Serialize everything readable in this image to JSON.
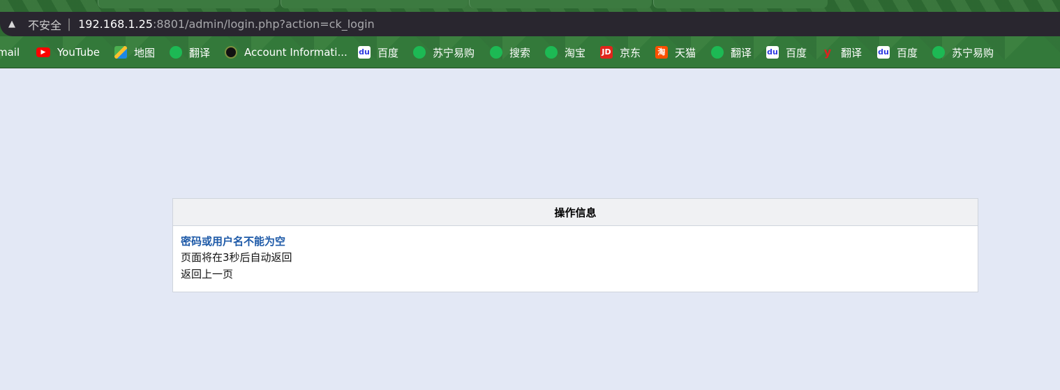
{
  "browser": {
    "insecure_label": "不安全",
    "url_host": "192.168.1.25",
    "url_rest": ":8801/admin/login.php?action=ck_login"
  },
  "bookmarks": [
    {
      "label": "mail",
      "icon": "gmail-icon"
    },
    {
      "label": "YouTube",
      "icon": "youtube-icon"
    },
    {
      "label": "地图",
      "icon": "maps-icon"
    },
    {
      "label": "翻译",
      "icon": "globe-icon"
    },
    {
      "label": "Account Informati...",
      "icon": "account-icon"
    },
    {
      "label": "百度",
      "icon": "baidu-icon"
    },
    {
      "label": "苏宁易购",
      "icon": "globe-icon"
    },
    {
      "label": "搜索",
      "icon": "globe-icon"
    },
    {
      "label": "淘宝",
      "icon": "globe-icon"
    },
    {
      "label": "京东",
      "icon": "jd-icon"
    },
    {
      "label": "天猫",
      "icon": "taobao-icon"
    },
    {
      "label": "翻译",
      "icon": "globe-icon"
    },
    {
      "label": "百度",
      "icon": "baidu-icon"
    },
    {
      "label": "翻译",
      "icon": "youdao-icon"
    },
    {
      "label": "百度",
      "icon": "baidu-icon"
    },
    {
      "label": "苏宁易购",
      "icon": "globe-icon"
    }
  ],
  "panel": {
    "title": "操作信息",
    "message": "密码或用户名不能为空",
    "redirect_text": "页面将在3秒后自动返回",
    "back_link": "返回上一页"
  }
}
